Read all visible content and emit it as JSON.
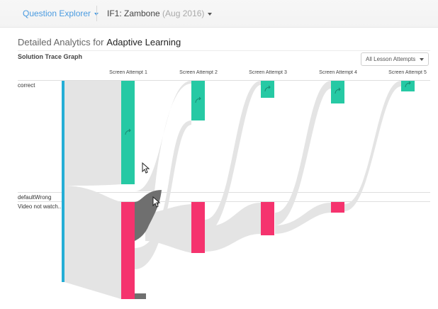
{
  "topbar": {
    "nav_label": "Question Explorer",
    "course_name": "IF1: Zambone",
    "course_date": "(Aug 2016)"
  },
  "page": {
    "heading_prefix": "Detailed Analytics for",
    "heading_subject": "Adaptive Learning",
    "graph_title": "Solution Trace Graph",
    "filter_value": "All Lesson Attempts"
  },
  "graph": {
    "columns": [
      "Screen Attempt 1",
      "Screen Attempt 2",
      "Screen Attempt 3",
      "Screen Attempt 4",
      "Screen Attempt 5"
    ],
    "rows": [
      "correct",
      "defaultWrong",
      "Video not watch..."
    ],
    "colors": {
      "correct": "#26c9a4",
      "incorrect": "#f5336e",
      "start": "#24aed6",
      "flow": "#e4e4e4",
      "flow_highlight": "#6f6f6f"
    },
    "node_icon": "redo-arrow-icon"
  }
}
